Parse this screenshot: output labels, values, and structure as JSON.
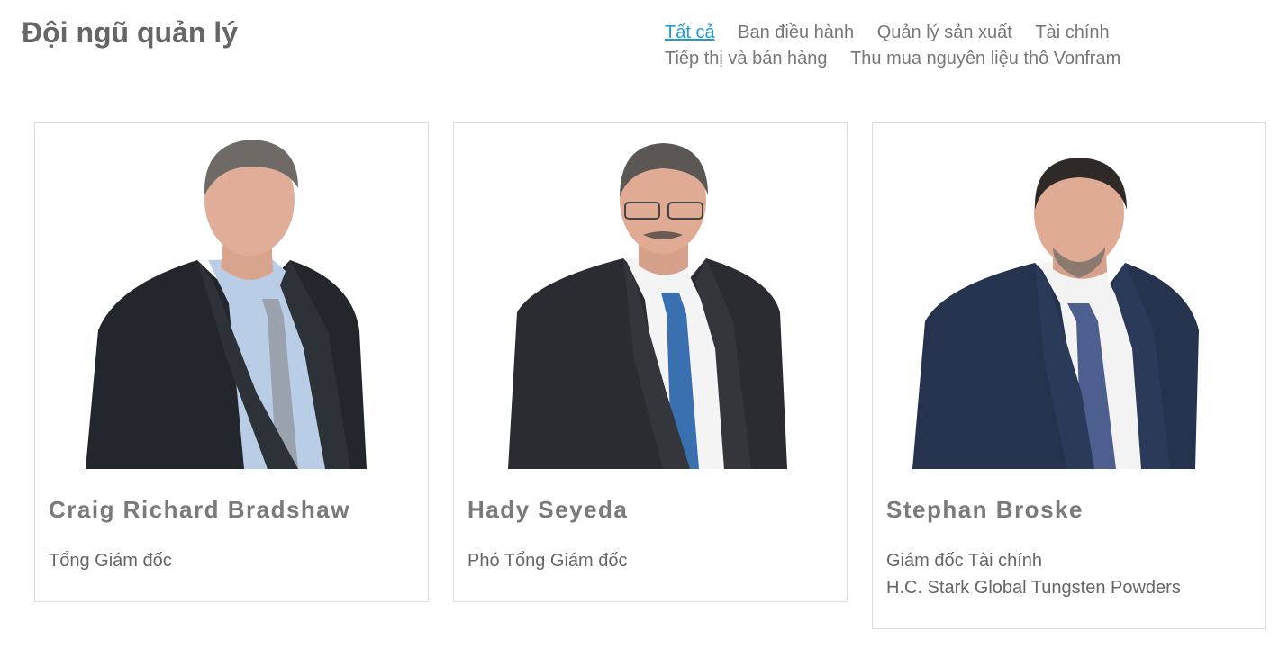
{
  "page": {
    "title": "Đội ngũ quản lý"
  },
  "filters": [
    {
      "label": "Tất cả",
      "active": true
    },
    {
      "label": "Ban điều hành",
      "active": false
    },
    {
      "label": "Quản lý sản xuất",
      "active": false
    },
    {
      "label": "Tài chính",
      "active": false
    },
    {
      "label": "Tiếp thị và bán hàng",
      "active": false
    },
    {
      "label": "Thu mua nguyên liệu thô Vonfram",
      "active": false
    }
  ],
  "colors": {
    "accent": "#1e9bd7",
    "text": "#666666",
    "border": "#dcdcdc"
  },
  "people": [
    {
      "name": "Craig Richard Bradshaw",
      "role_line1": "Tổng Giám đốc",
      "role_line2": "",
      "photo_icon": "person-photo"
    },
    {
      "name": "Hady Seyeda",
      "role_line1": "Phó Tổng Giám đốc",
      "role_line2": "",
      "photo_icon": "person-photo"
    },
    {
      "name": "Stephan Broske",
      "role_line1": "Giám đốc Tài chính",
      "role_line2": "H.C. Stark Global Tungsten Powders",
      "photo_icon": "person-photo"
    }
  ]
}
